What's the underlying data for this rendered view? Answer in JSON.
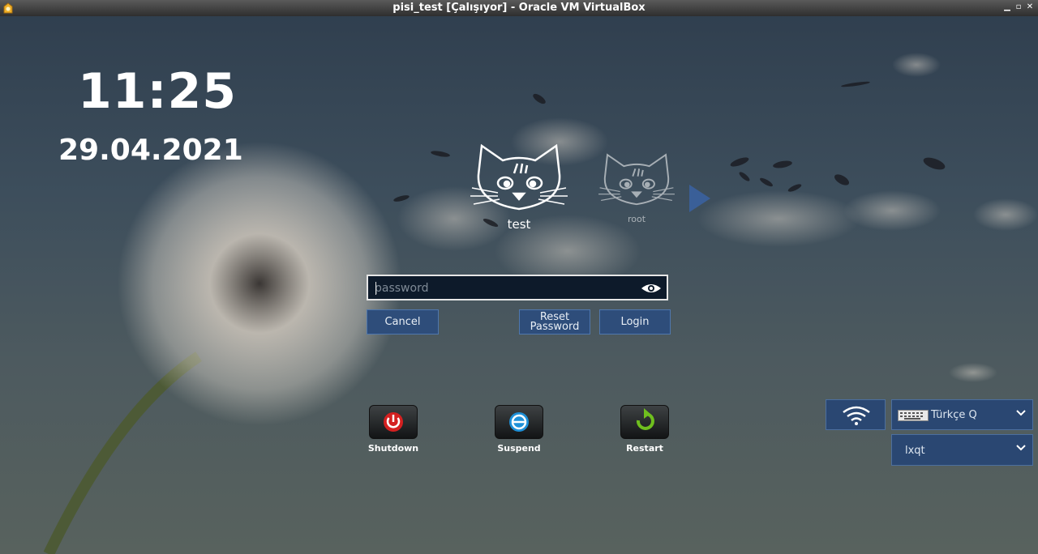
{
  "window": {
    "title": "pisi_test [Çalışıyor] - Oracle VM VirtualBox",
    "controls": [
      "minimize-icon",
      "restore-icon",
      "close-icon"
    ]
  },
  "clock": {
    "time": "11:25",
    "date": "29.04.2021"
  },
  "users": [
    {
      "name": "test",
      "selected": true,
      "icon": "cat-avatar-icon"
    },
    {
      "name": "root",
      "selected": false,
      "icon": "cat-avatar-icon"
    }
  ],
  "login": {
    "password_placeholder": "password",
    "password_value": "",
    "cancel": "Cancel",
    "reset_line1": "Reset",
    "reset_line2": "Password",
    "login": "Login"
  },
  "power": {
    "shutdown": "Shutdown",
    "suspend": "Suspend",
    "restart": "Restart"
  },
  "panel": {
    "keyboard_layout": "Türkçe Q",
    "session": "lxqt"
  },
  "colors": {
    "accent": "#2e4d7a",
    "accent_border": "#4f77ad",
    "shutdown": "#d42020",
    "suspend": "#1e90d8",
    "restart": "#6fbf1e"
  }
}
